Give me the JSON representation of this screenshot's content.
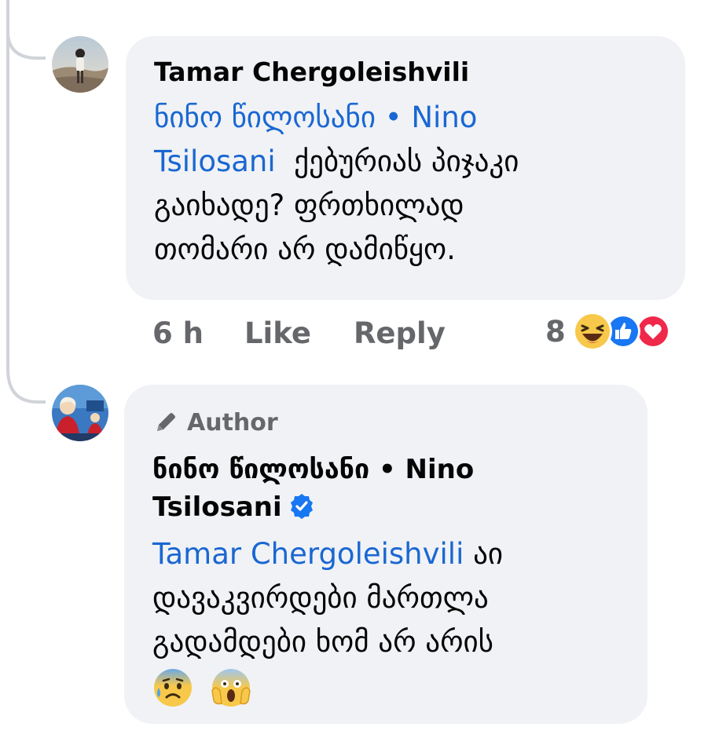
{
  "comments": [
    {
      "author": "Tamar Chergoleishvili",
      "mention": "ნინო წილოსანი • Nino Tsilosani",
      "mention_line1": "ნინო წილოსანი • Nino",
      "mention_line2": "Tsilosani",
      "text_line1": "ქებურიას პიჯაკი",
      "text_line2": "გაიხადე? ფრთხილად",
      "text_line3": "თომარი არ დამიწყო.",
      "time": "6 h",
      "like_label": "Like",
      "reply_label": "Reply",
      "reaction_count": "8",
      "reactions": [
        "haha-icon",
        "like-icon",
        "love-icon"
      ]
    },
    {
      "badge": "Author",
      "author_line1": "ნინო წილოსანი • Nino",
      "author_line2": "Tsilosani",
      "verified": true,
      "mention": "Tamar Chergoleishvili",
      "text_after_mention": "აი",
      "text_line2": "დავაკვირდები მართლა",
      "text_line3": "გადამდები ხომ არ არის",
      "emojis": [
        "anxious-face-icon",
        "screaming-face-icon"
      ]
    }
  ],
  "colors": {
    "bubble": "#f0f2f5",
    "mention": "#1a67d2",
    "muted": "#65676b",
    "verified": "#1877f2"
  }
}
